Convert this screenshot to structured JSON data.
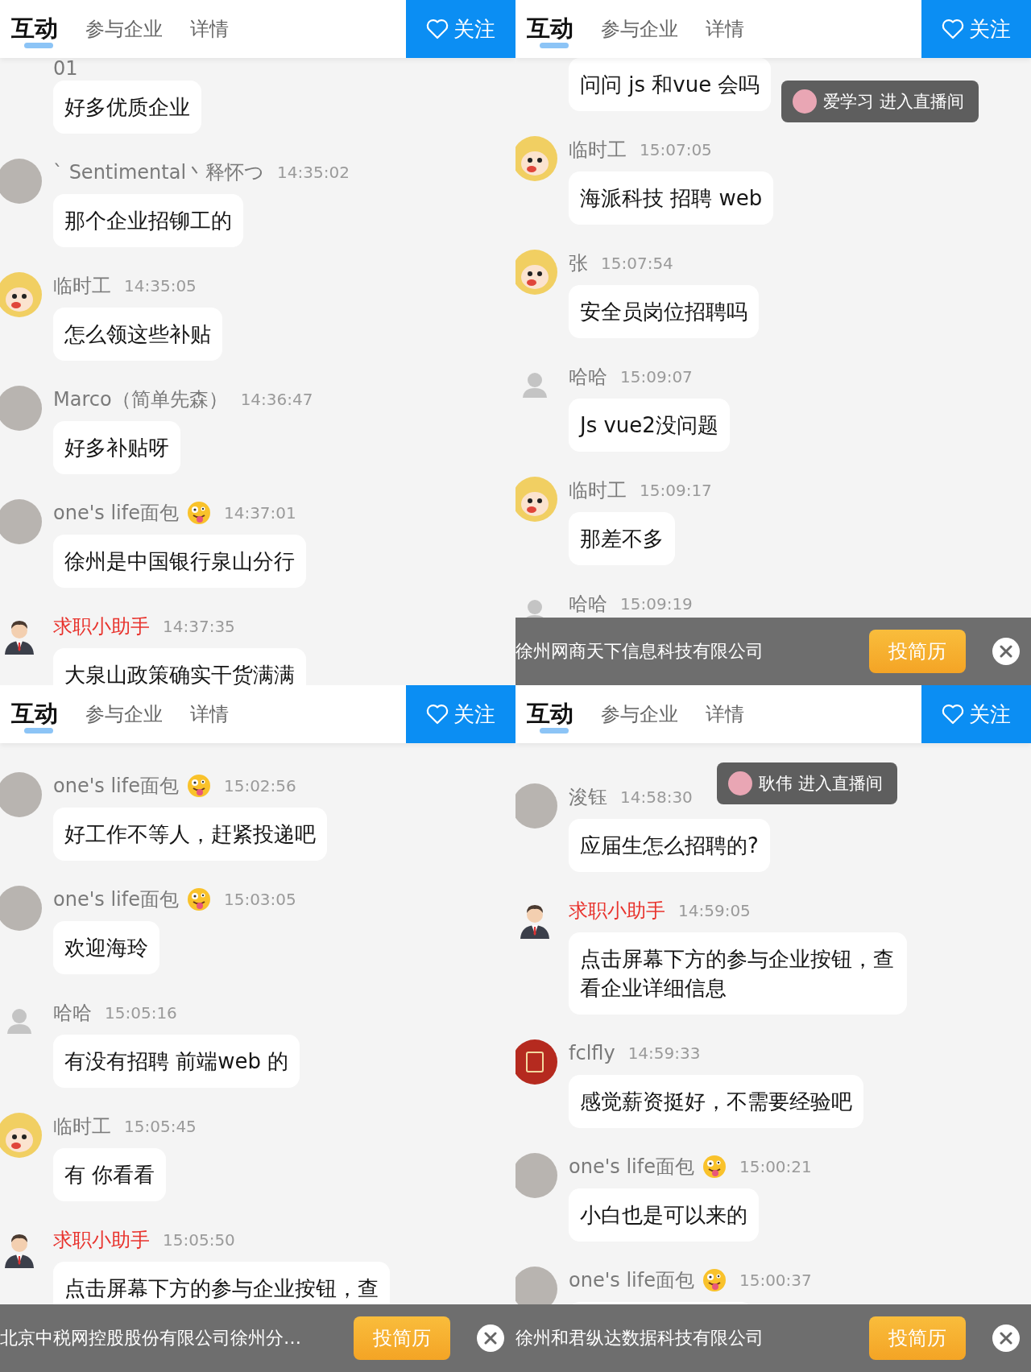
{
  "panels": [
    {
      "tabs": [
        {
          "label": "互动",
          "selected": true
        },
        {
          "label": "参与企业",
          "selected": false
        },
        {
          "label": "详情",
          "selected": false
        }
      ],
      "follow_button": "关注",
      "messages": [
        {
          "name": "01",
          "emoji": false,
          "assistant": false,
          "text": "好多优质企业"
        },
        {
          "avatar": {
            "kind": "photo"
          },
          "name": "ˋ Sentimental丶释怀つ",
          "emoji": false,
          "time": "14:35:02",
          "assistant": false,
          "text": "那个企业招铆工的"
        },
        {
          "avatar": {
            "kind": "cartoon"
          },
          "name": "临时工",
          "emoji": false,
          "time": "14:35:05",
          "assistant": false,
          "text": "怎么领这些补贴"
        },
        {
          "avatar": {
            "kind": "photo"
          },
          "name": "Marco（简单先森）",
          "emoji": false,
          "time": "14:36:47",
          "assistant": false,
          "text": "好多补贴呀"
        },
        {
          "avatar": {
            "kind": "photo"
          },
          "name": "one's life面包",
          "emoji": true,
          "time": "14:37:01",
          "assistant": false,
          "text": "徐州是中国银行泉山分行"
        },
        {
          "avatar": {
            "kind": "agent"
          },
          "name": "求职小助手",
          "emoji": false,
          "time": "14:37:35",
          "assistant": true,
          "text": "大泉山政策确实干货满满"
        }
      ]
    },
    {
      "tabs": [
        {
          "label": "互动",
          "selected": true
        },
        {
          "label": "参与企业",
          "selected": false
        },
        {
          "label": "详情",
          "selected": false
        }
      ],
      "follow_button": "关注",
      "messages": [
        {
          "text": "问问 js 和vue 会吗"
        },
        {
          "avatar": {
            "kind": "cartoon"
          },
          "name": "临时工",
          "emoji": false,
          "time": "15:07:05",
          "assistant": false,
          "text": "海派科技 招聘 web"
        },
        {
          "avatar": {
            "kind": "cartoon"
          },
          "name": "张",
          "emoji": false,
          "time": "15:07:54",
          "assistant": false,
          "text": "安全员岗位招聘吗"
        },
        {
          "avatar": {
            "kind": "default"
          },
          "name": "哈哈",
          "emoji": false,
          "time": "15:09:07",
          "assistant": false,
          "text": "Js vue2没问题"
        },
        {
          "avatar": {
            "kind": "cartoon"
          },
          "name": "临时工",
          "emoji": false,
          "time": "15:09:17",
          "assistant": false,
          "text": "那差不多"
        },
        {
          "avatar": {
            "kind": "default"
          },
          "name": "哈哈",
          "emoji": false,
          "time": "15:09:19",
          "assistant": false
        }
      ],
      "toast": {
        "text": "爱学习 进入直播间"
      },
      "job_banner": {
        "company": "徐州网商天下信息科技有限公司",
        "button": "投简历"
      }
    },
    {
      "tabs": [
        {
          "label": "互动",
          "selected": true
        },
        {
          "label": "参与企业",
          "selected": false
        },
        {
          "label": "详情",
          "selected": false
        }
      ],
      "follow_button": "关注",
      "messages": [
        {
          "avatar": {
            "kind": "photo"
          },
          "name": "one's life面包",
          "emoji": true,
          "time": "15:02:56",
          "assistant": false,
          "text": "好工作不等人，赶紧投递吧"
        },
        {
          "avatar": {
            "kind": "photo"
          },
          "name": "one's life面包",
          "emoji": true,
          "time": "15:03:05",
          "assistant": false,
          "text": "欢迎海玲"
        },
        {
          "avatar": {
            "kind": "default"
          },
          "name": "哈哈",
          "emoji": false,
          "time": "15:05:16",
          "assistant": false,
          "text": "有没有招聘 前端web 的"
        },
        {
          "avatar": {
            "kind": "cartoon"
          },
          "name": "临时工",
          "emoji": false,
          "time": "15:05:45",
          "assistant": false,
          "text": "有 你看看"
        },
        {
          "avatar": {
            "kind": "agent"
          },
          "name": "求职小助手",
          "emoji": false,
          "time": "15:05:50",
          "assistant": true,
          "text": "点击屏幕下方的参与企业按钮，查"
        }
      ],
      "job_banner": {
        "company": "北京中税网控股股份有限公司徐州分…",
        "button": "投简历"
      }
    },
    {
      "tabs": [
        {
          "label": "互动",
          "selected": true
        },
        {
          "label": "参与企业",
          "selected": false
        },
        {
          "label": "详情",
          "selected": false
        }
      ],
      "follow_button": "关注",
      "messages": [
        {
          "avatar": {
            "kind": "photo"
          },
          "name": "浚钰",
          "emoji": false,
          "time": "14:58:30",
          "assistant": false,
          "text": "应届生怎么招聘的?"
        },
        {
          "avatar": {
            "kind": "agent"
          },
          "name": "求职小助手",
          "emoji": false,
          "time": "14:59:05",
          "assistant": true,
          "text": "点击屏幕下方的参与企业按钮，查看企业详细信息"
        },
        {
          "avatar": {
            "kind": "seal"
          },
          "name": "fclfly",
          "emoji": false,
          "time": "14:59:33",
          "assistant": false,
          "text": "感觉薪资挺好，不需要经验吧"
        },
        {
          "avatar": {
            "kind": "photo"
          },
          "name": "one's life面包",
          "emoji": true,
          "time": "15:00:21",
          "assistant": false,
          "text": "小白也是可以来的"
        },
        {
          "avatar": {
            "kind": "photo"
          },
          "name": "one's life面包",
          "emoji": true,
          "time": "15:00:37",
          "assistant": false
        }
      ],
      "toast": {
        "text": "耿伟 进入直播间"
      },
      "job_banner": {
        "company": "徐州和君纵达数据科技有限公司",
        "button": "投简历"
      }
    }
  ]
}
